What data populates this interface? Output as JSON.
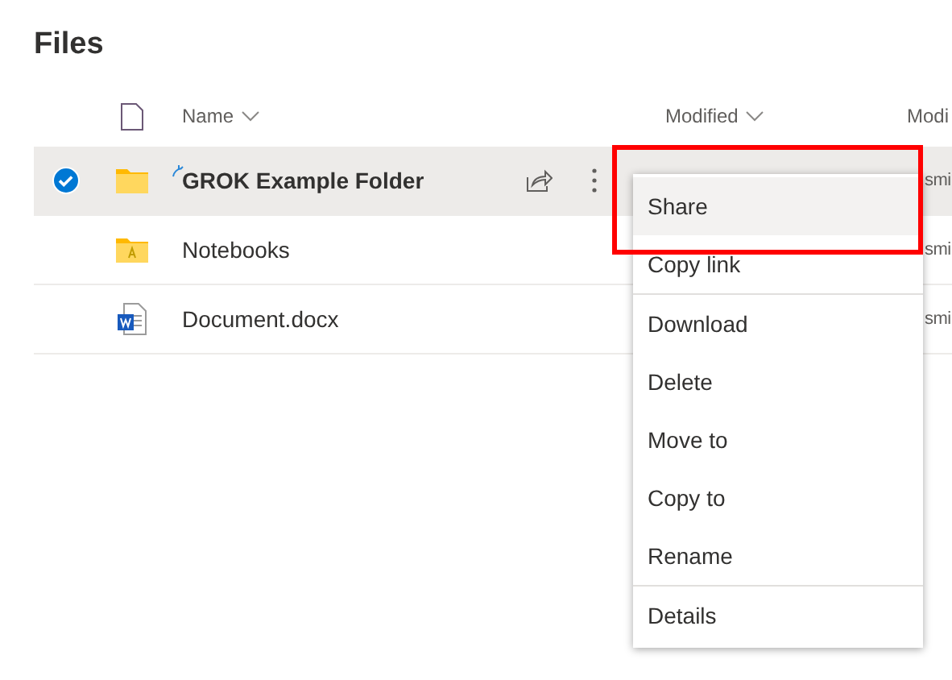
{
  "title": "Files",
  "table": {
    "columns": [
      {
        "label": "Name",
        "sort_caret": true
      },
      {
        "label": "Modified",
        "sort_caret": true
      },
      {
        "label": "Modi",
        "sort_caret": false
      }
    ],
    "rows": [
      {
        "name": "GROK Example Folder",
        "kind": "folder",
        "selected": true,
        "syncing": true,
        "column_4": "smi"
      },
      {
        "name": "Notebooks",
        "kind": "notebook-folder",
        "selected": false,
        "syncing": false,
        "column_4": "smi"
      },
      {
        "name": "Document.docx",
        "kind": "word",
        "selected": false,
        "syncing": false,
        "column_4": "smi"
      }
    ]
  },
  "context_menu": {
    "groups": [
      {
        "items": [
          {
            "label": "Share",
            "highlighted": true
          },
          {
            "label": "Copy link",
            "highlighted": false
          }
        ]
      },
      {
        "items": [
          {
            "label": "Download",
            "highlighted": false
          },
          {
            "label": "Delete",
            "highlighted": false
          },
          {
            "label": "Move to",
            "highlighted": false
          },
          {
            "label": "Copy to",
            "highlighted": false
          },
          {
            "label": "Rename",
            "highlighted": false
          }
        ]
      },
      {
        "items": [
          {
            "label": "Details",
            "highlighted": false
          }
        ]
      }
    ]
  },
  "annotation": {
    "kind": "highlight-frame"
  }
}
